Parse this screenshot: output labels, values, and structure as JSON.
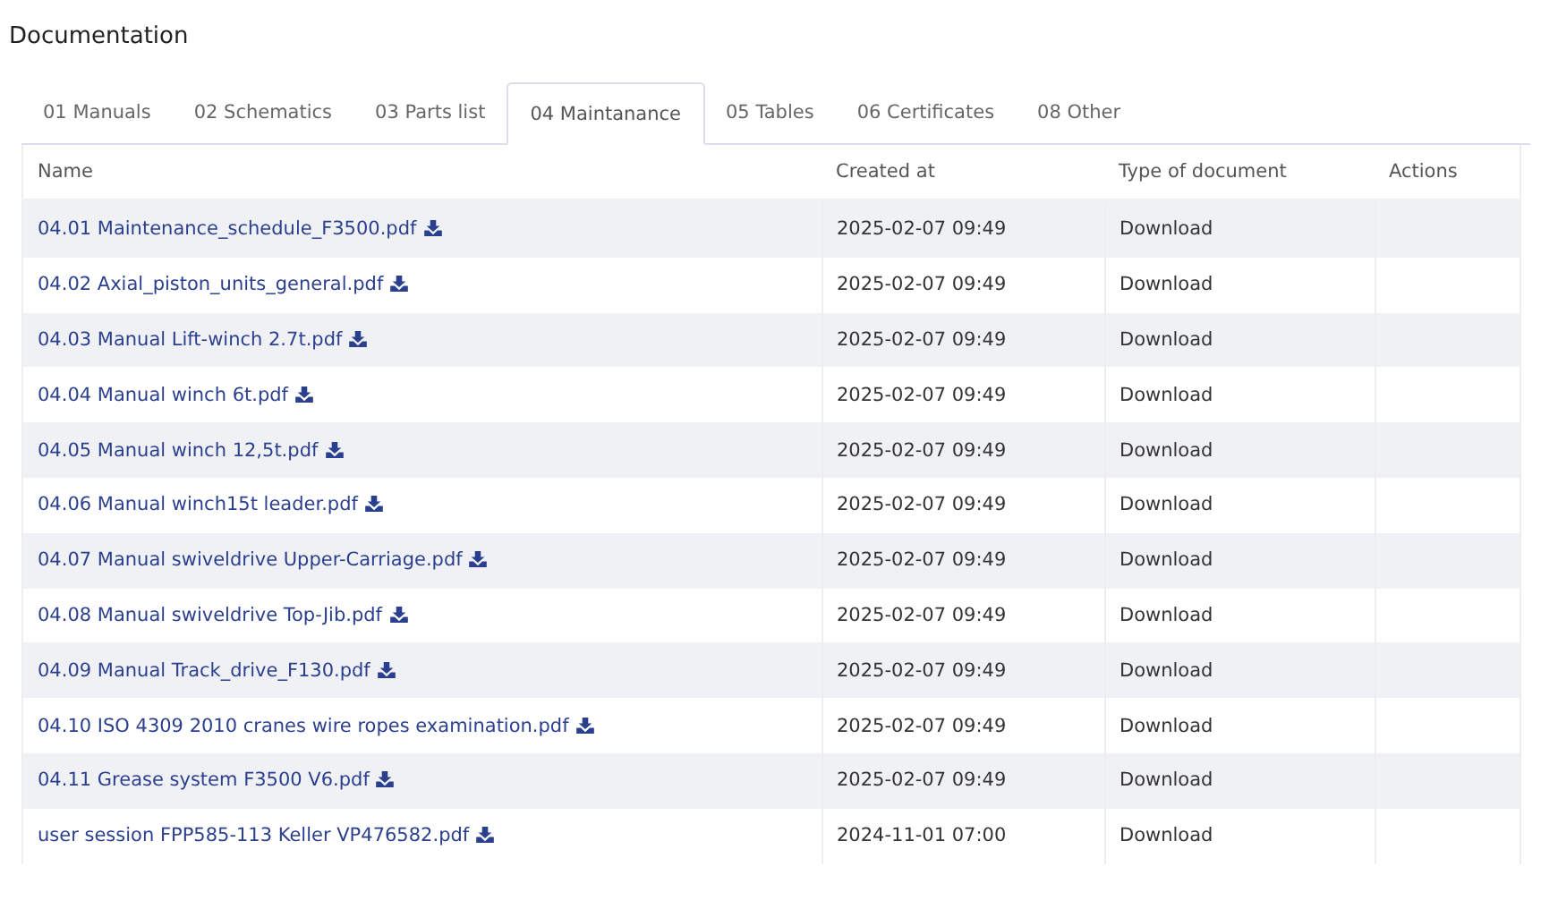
{
  "title": "Documentation",
  "tabs": [
    {
      "label": "01 Manuals",
      "selected": false
    },
    {
      "label": "02 Schematics",
      "selected": false
    },
    {
      "label": "03 Parts list",
      "selected": false
    },
    {
      "label": "04 Maintanance",
      "selected": true
    },
    {
      "label": "05 Tables",
      "selected": false
    },
    {
      "label": "06 Certificates",
      "selected": false
    },
    {
      "label": "08 Other",
      "selected": false
    }
  ],
  "table": {
    "columns": [
      "Name",
      "Created at",
      "Type of document",
      "Actions"
    ],
    "rows": [
      {
        "name": "04.01 Maintenance_schedule_F3500.pdf",
        "created_at": "2025-02-07 09:49",
        "type": "Download"
      },
      {
        "name": "04.02 Axial_piston_units_general.pdf",
        "created_at": "2025-02-07 09:49",
        "type": "Download"
      },
      {
        "name": "04.03 Manual Lift-winch 2.7t.pdf",
        "created_at": "2025-02-07 09:49",
        "type": "Download"
      },
      {
        "name": "04.04 Manual winch 6t.pdf",
        "created_at": "2025-02-07 09:49",
        "type": "Download"
      },
      {
        "name": "04.05 Manual winch 12,5t.pdf",
        "created_at": "2025-02-07 09:49",
        "type": "Download"
      },
      {
        "name": "04.06 Manual winch15t leader.pdf",
        "created_at": "2025-02-07 09:49",
        "type": "Download"
      },
      {
        "name": "04.07 Manual swiveldrive Upper-Carriage.pdf",
        "created_at": "2025-02-07 09:49",
        "type": "Download"
      },
      {
        "name": "04.08 Manual swiveldrive Top-Jib.pdf",
        "created_at": "2025-02-07 09:49",
        "type": "Download"
      },
      {
        "name": "04.09 Manual Track_drive_F130.pdf",
        "created_at": "2025-02-07 09:49",
        "type": "Download"
      },
      {
        "name": "04.10 ISO 4309 2010 cranes wire ropes examination.pdf",
        "created_at": "2025-02-07 09:49",
        "type": "Download"
      },
      {
        "name": "04.11 Grease system F3500 V6.pdf",
        "created_at": "2025-02-07 09:49",
        "type": "Download"
      },
      {
        "name": "user session FPP585-113 Keller VP476582.pdf",
        "created_at": "2024-11-01 07:00",
        "type": "Download"
      }
    ]
  }
}
